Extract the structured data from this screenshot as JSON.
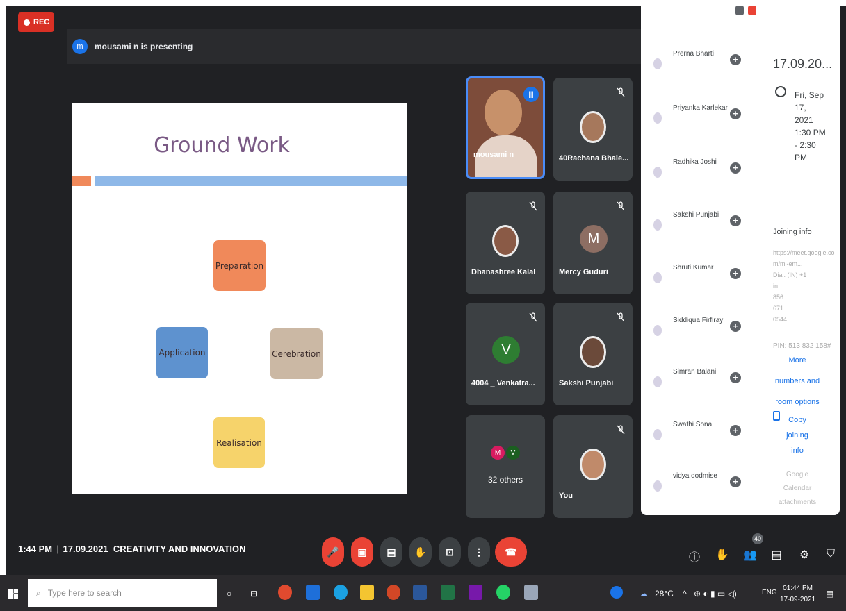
{
  "rec_label": "REC",
  "presenting": {
    "avatar_letter": "m",
    "text": "mousami n is presenting"
  },
  "slide": {
    "title": "Ground Work",
    "boxes": {
      "preparation": "Preparation",
      "application": "Application",
      "cerebration": "Cerebration",
      "realisation": "Realisation"
    }
  },
  "tiles": [
    {
      "name": "mousami n"
    },
    {
      "name": "40Rachana Bhale..."
    },
    {
      "name": "Dhanashree Kalal"
    },
    {
      "name": "Mercy Guduri",
      "letter": "M"
    },
    {
      "name": "4004 _ Venkatra...",
      "letter": "V"
    },
    {
      "name": "Sakshi Punjabi"
    },
    {
      "name": "32 others",
      "minis": [
        "M",
        "V"
      ]
    },
    {
      "name": "You"
    }
  ],
  "panel": {
    "participants": [
      {
        "name": "Prerna Bharti"
      },
      {
        "name": "Priyanka Karlekar"
      },
      {
        "name": "Radhika Joshi"
      },
      {
        "name": "Sakshi Punjabi"
      },
      {
        "name": "Shruti Kumar"
      },
      {
        "name": "Siddiqua Firfiray"
      },
      {
        "name": "Simran Balani"
      },
      {
        "name": "Swathi Sona"
      },
      {
        "name": "vidya dodmise"
      }
    ],
    "meeting_date": "17.09.20...",
    "schedule": [
      "Fri, Sep",
      "17,",
      "2021",
      "1:30 PM",
      "- 2:30",
      "PM"
    ],
    "joining_info": "Joining info",
    "meet_link": "https://meet.google.com/mi-em...",
    "dial": "Dial: (IN) +1",
    "dial_numbers": [
      "in",
      "856",
      "671",
      "0544"
    ],
    "pin": "PIN: 513 832 158#",
    "more": [
      "More",
      "numbers and",
      "room options"
    ],
    "copy": [
      "Copy",
      "joining",
      "info"
    ],
    "calendar": [
      "Google",
      "Calendar",
      "attachments"
    ]
  },
  "bottom": {
    "time": "1:44 PM",
    "meeting_title": "17.09.2021_CREATIVITY AND INNOVATION",
    "participant_count": "40"
  },
  "taskbar": {
    "search_placeholder": "Type here to search",
    "temperature": "28°C",
    "language": "ENG",
    "time": "01:44 PM",
    "date": "17-09-2021"
  }
}
